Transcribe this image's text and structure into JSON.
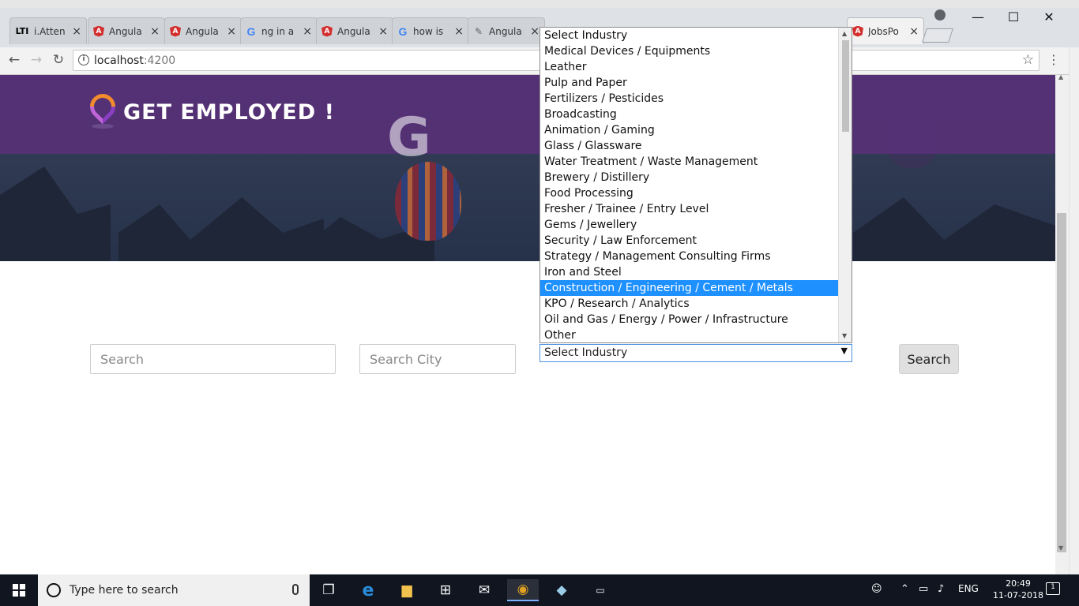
{
  "browser": {
    "tabs": [
      {
        "icon": "lti-icon",
        "favicon_text": "LTI",
        "label": "i.Atten",
        "close": "×"
      },
      {
        "icon": "angular-icon",
        "label": "Angula",
        "close": "×"
      },
      {
        "icon": "angular-icon",
        "label": "Angula",
        "close": "×"
      },
      {
        "icon": "google-icon",
        "favicon_text": "G",
        "label": "ng in a",
        "close": "×"
      },
      {
        "icon": "angular-icon",
        "label": "Angula",
        "close": "×"
      },
      {
        "icon": "google-icon",
        "favicon_text": "G",
        "label": "how is",
        "close": "×"
      },
      {
        "icon": "extension-icon",
        "favicon_text": "✎",
        "label": "Angula",
        "close": "×"
      },
      {
        "icon": "angular-icon",
        "label": "JobsPo",
        "close": "×",
        "active": true
      }
    ],
    "url_host": "localhost",
    "url_port": ":4200",
    "window_controls": {
      "minimize": "—",
      "maximize": "☐",
      "close": "✕"
    }
  },
  "page": {
    "brand_title": "GET EMPLOYED !",
    "search_placeholder": "Search",
    "city_placeholder": "Search City",
    "industry_select_value": "Select Industry",
    "search_button": "Search",
    "industry_options": [
      "Select Industry",
      "Medical Devices / Equipments",
      "Leather",
      "Pulp and Paper",
      "Fertilizers / Pesticides",
      "Broadcasting",
      "Animation / Gaming",
      "Glass / Glassware",
      "Water Treatment / Waste Management",
      "Brewery / Distillery",
      "Food Processing",
      "Fresher / Trainee / Entry Level",
      "Gems / Jewellery",
      "Security / Law Enforcement",
      "Strategy / Management Consulting Firms",
      "Iron and Steel",
      "Construction / Engineering / Cement / Metals",
      "KPO / Research / Analytics",
      "Oil and Gas / Energy / Power / Infrastructure",
      "Other"
    ],
    "highlighted_option": "Construction / Engineering / Cement / Metals"
  },
  "taskbar": {
    "search_text": "Type here to search",
    "language": "ENG",
    "time": "20:49",
    "date": "11-07-2018",
    "notification_count": "1"
  },
  "colors": {
    "header_band": "#583078",
    "selected_option": "#1e90ff",
    "select_border": "#4a90e2"
  }
}
